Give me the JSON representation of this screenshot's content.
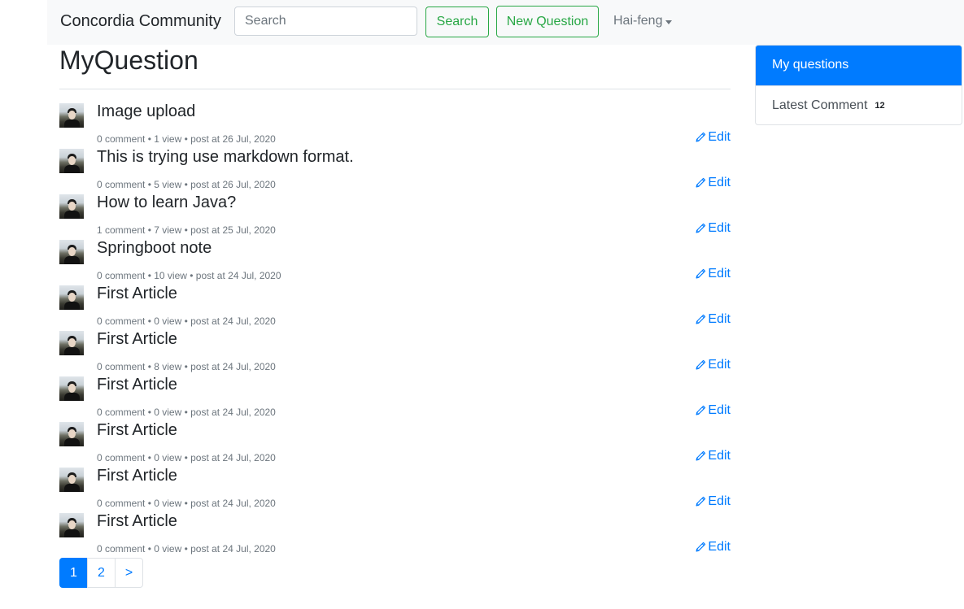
{
  "navbar": {
    "brand": "Concordia Community",
    "search_placeholder": "Search",
    "search_button": "Search",
    "new_question_button": "New Question",
    "user_name": "Hai-feng"
  },
  "main": {
    "title": "MyQuestion",
    "edit_label": "Edit",
    "questions": [
      {
        "title": "Image upload",
        "meta": "0 comment • 1 view • post at 26 Jul, 2020"
      },
      {
        "title": "This is trying use markdown format.",
        "meta": "0 comment • 5 view • post at 26 Jul, 2020"
      },
      {
        "title": "How to learn Java?",
        "meta": "1 comment • 7 view • post at 25 Jul, 2020"
      },
      {
        "title": "Springboot note",
        "meta": "0 comment • 10 view • post at 24 Jul, 2020"
      },
      {
        "title": "First Article",
        "meta": "0 comment • 0 view • post at 24 Jul, 2020"
      },
      {
        "title": "First Article",
        "meta": "0 comment • 8 view • post at 24 Jul, 2020"
      },
      {
        "title": "First Article",
        "meta": "0 comment • 0 view • post at 24 Jul, 2020"
      },
      {
        "title": "First Article",
        "meta": "0 comment • 0 view • post at 24 Jul, 2020"
      },
      {
        "title": "First Article",
        "meta": "0 comment • 0 view • post at 24 Jul, 2020"
      },
      {
        "title": "First Article",
        "meta": "0 comment • 0 view • post at 24 Jul, 2020"
      }
    ]
  },
  "pagination": {
    "pages": [
      "1",
      "2",
      ">"
    ],
    "active_page": "1"
  },
  "sidebar": {
    "items": [
      {
        "label": "My questions",
        "active": true
      },
      {
        "label": "Latest Comment",
        "badge": "12",
        "active": false
      }
    ]
  },
  "colors": {
    "primary": "#007bff",
    "success": "#28a745",
    "navbar_bg": "#f8f9fa",
    "muted": "#6c757d"
  },
  "icons": {
    "edit": "pencil-icon",
    "dropdown": "caret-down-icon"
  }
}
